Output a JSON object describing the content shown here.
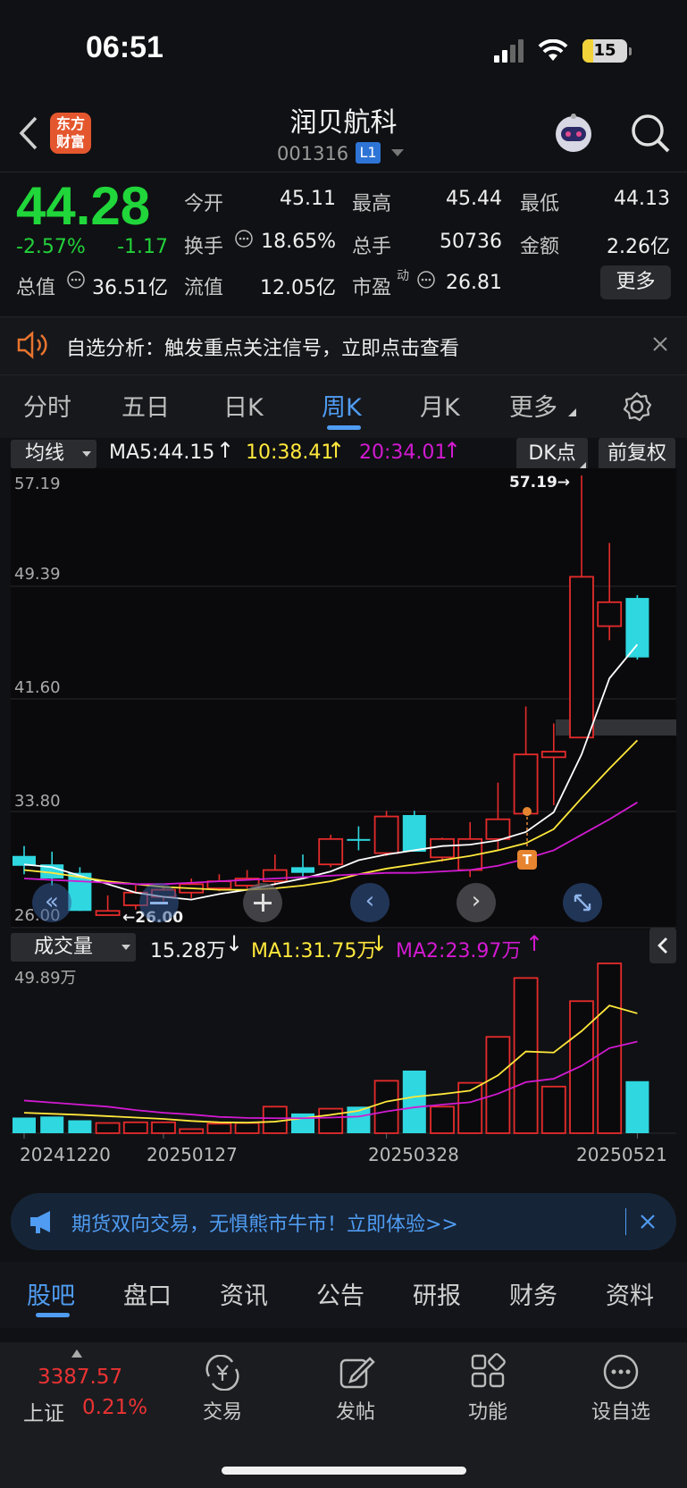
{
  "status": {
    "time": "06:51",
    "battery": "15"
  },
  "header": {
    "title": "润贝航科",
    "code": "001316",
    "level_badge": "L1",
    "logo_text": "东方\n财富"
  },
  "quote": {
    "price": "44.28",
    "change_pct": "-2.57%",
    "change": "-1.17",
    "open_label": "今开",
    "open": "45.11",
    "high_label": "最高",
    "high": "45.44",
    "low_label": "最低",
    "low": "44.13",
    "turnover_label": "换手",
    "turnover": "18.65%",
    "volume_label": "总手",
    "volume": "50736",
    "amount_label": "金额",
    "amount": "2.26亿",
    "mktcap_label": "总值",
    "mktcap": "36.51亿",
    "float_label": "流值",
    "float": "12.05亿",
    "pe_label": "市盈",
    "pe_sup": "动",
    "pe": "26.81",
    "more": "更多"
  },
  "alert": {
    "text": "自选分析：触发重点关注信号，立即点击查看"
  },
  "tabs": [
    "分时",
    "五日",
    "日K",
    "周K",
    "月K",
    "更多"
  ],
  "active_tab": 3,
  "kline": {
    "ma_selector": "均线",
    "ma5": "MA5:44.15",
    "ma10": "10:38.41",
    "ma20": "20:34.01",
    "dk_label": "DK点",
    "adjust_label": "前复权",
    "high_marker": "57.19→",
    "low_marker": "←26.00",
    "t_marker": "T"
  },
  "volume_panel": {
    "selector": "成交量",
    "vol": "15.28万",
    "ma1": "MA1:31.75万",
    "ma2": "MA2:23.97万",
    "max_label": "49.89万"
  },
  "chart_data": {
    "type": "candlestick",
    "y_ticks": [
      "57.19",
      "49.39",
      "41.60",
      "33.80",
      "26.00"
    ],
    "ylim": [
      26.0,
      57.19
    ],
    "x_ticks": [
      "20241220",
      "20250127",
      "20250328",
      "20250521"
    ],
    "candles": [
      {
        "o": 30.2,
        "c": 29.5,
        "h": 30.9,
        "l": 28.9,
        "up": false
      },
      {
        "o": 29.6,
        "c": 28.6,
        "h": 30.5,
        "l": 28.1,
        "up": false
      },
      {
        "o": 29.0,
        "c": 26.3,
        "h": 29.4,
        "l": 26.3,
        "up": false
      },
      {
        "o": 26.0,
        "c": 26.3,
        "h": 27.4,
        "l": 26.0,
        "up": true
      },
      {
        "o": 26.7,
        "c": 27.6,
        "h": 28.1,
        "l": 26.4,
        "up": true
      },
      {
        "o": 27.3,
        "c": 27.8,
        "h": 28.1,
        "l": 27.0,
        "up": true
      },
      {
        "o": 27.6,
        "c": 28.2,
        "h": 28.6,
        "l": 27.2,
        "up": true
      },
      {
        "o": 27.9,
        "c": 28.4,
        "h": 28.9,
        "l": 27.7,
        "up": true
      },
      {
        "o": 28.1,
        "c": 28.6,
        "h": 29.2,
        "l": 27.9,
        "up": true
      },
      {
        "o": 28.4,
        "c": 29.2,
        "h": 30.3,
        "l": 28.1,
        "up": true
      },
      {
        "o": 29.4,
        "c": 29.0,
        "h": 30.3,
        "l": 28.7,
        "up": false
      },
      {
        "o": 29.6,
        "c": 31.4,
        "h": 31.7,
        "l": 29.4,
        "up": true
      },
      {
        "o": 31.4,
        "c": 31.4,
        "h": 32.3,
        "l": 30.6,
        "up": false
      },
      {
        "o": 30.4,
        "c": 33.0,
        "h": 33.4,
        "l": 30.2,
        "up": true
      },
      {
        "o": 33.1,
        "c": 30.5,
        "h": 33.4,
        "l": 30.5,
        "up": false
      },
      {
        "o": 30.1,
        "c": 31.4,
        "h": 31.5,
        "l": 29.8,
        "up": true
      },
      {
        "o": 29.2,
        "c": 31.4,
        "h": 32.6,
        "l": 28.7,
        "up": true
      },
      {
        "o": 31.4,
        "c": 32.8,
        "h": 35.4,
        "l": 30.6,
        "up": true
      },
      {
        "o": 33.2,
        "c": 37.4,
        "h": 40.8,
        "l": 33.1,
        "up": true
      },
      {
        "o": 37.2,
        "c": 37.6,
        "h": 39.6,
        "l": 33.8,
        "up": true
      },
      {
        "o": 38.6,
        "c": 50.0,
        "h": 57.19,
        "l": 38.6,
        "up": true
      },
      {
        "o": 46.5,
        "c": 48.2,
        "h": 52.4,
        "l": 45.5,
        "up": true
      },
      {
        "o": 48.5,
        "c": 44.28,
        "h": 48.7,
        "l": 44.13,
        "up": false
      }
    ],
    "ma_lines": [
      {
        "name": "MA5",
        "color": "#ffffff",
        "values": [
          29.6,
          29.4,
          28.8,
          28.2,
          27.6,
          27.3,
          27.1,
          27.5,
          27.8,
          28.2,
          28.6,
          29.1,
          29.9,
          30.3,
          30.6,
          30.9,
          31.0,
          31.3,
          31.9,
          33.3,
          37.4,
          42.8,
          45.2
        ]
      },
      {
        "name": "MA10",
        "color": "#ffe83c",
        "values": [
          29.2,
          29.0,
          28.7,
          28.4,
          28.2,
          28.0,
          27.9,
          27.8,
          27.8,
          27.9,
          28.1,
          28.4,
          28.9,
          29.3,
          29.6,
          29.9,
          30.2,
          30.6,
          31.1,
          32.1,
          34.3,
          36.4,
          38.4
        ]
      },
      {
        "name": "MA20",
        "color": "#d21ad2",
        "values": [
          28.6,
          28.5,
          28.4,
          28.3,
          28.2,
          28.2,
          28.3,
          28.4,
          28.5,
          28.6,
          28.7,
          28.8,
          28.9,
          29.0,
          29.0,
          29.1,
          29.2,
          29.5,
          30.0,
          30.6,
          31.7,
          32.8,
          34.0
        ]
      }
    ],
    "volume": {
      "max": 49.89,
      "values": [
        4.6,
        4.9,
        3.8,
        3.0,
        3.2,
        3.2,
        1.2,
        2.8,
        3.0,
        7.8,
        5.8,
        7.2,
        7.8,
        15.4,
        18.4,
        7.8,
        14.8,
        28.3,
        45.6,
        13.7,
        38.8,
        49.89,
        15.28
      ],
      "ma1": {
        "color": "#ffe83c",
        "values": [
          6.0,
          5.7,
          5.4,
          5.0,
          4.6,
          4.2,
          3.6,
          3.2,
          3.1,
          3.4,
          4.4,
          5.4,
          6.6,
          9.3,
          10.7,
          11.5,
          12.5,
          17.0,
          24.0,
          23.7,
          30.0,
          37.5,
          35.2
        ]
      },
      "ma2": {
        "color": "#d21ad2",
        "values": [
          9.6,
          9.0,
          8.4,
          7.8,
          6.8,
          6.0,
          5.5,
          4.8,
          4.5,
          4.4,
          4.4,
          4.6,
          4.9,
          6.4,
          7.6,
          8.4,
          9.1,
          11.6,
          15.0,
          16.0,
          19.8,
          25.0,
          26.9
        ]
      }
    }
  },
  "banner": {
    "text": "期货双向交易，无惧熊市牛市！立即体验>>"
  },
  "bottom_tabs": [
    "股吧",
    "盘口",
    "资讯",
    "公告",
    "研报",
    "财务",
    "资料"
  ],
  "bottom_nav": {
    "index_value": "3387.57",
    "index_name": "上证",
    "index_change": "0.21%",
    "items": [
      "交易",
      "发帖",
      "功能",
      "设自选"
    ]
  },
  "colors": {
    "up": "#e52b2b",
    "down": "#2fd7e0",
    "accent": "#4f9cf2",
    "green": "#22d13a"
  }
}
